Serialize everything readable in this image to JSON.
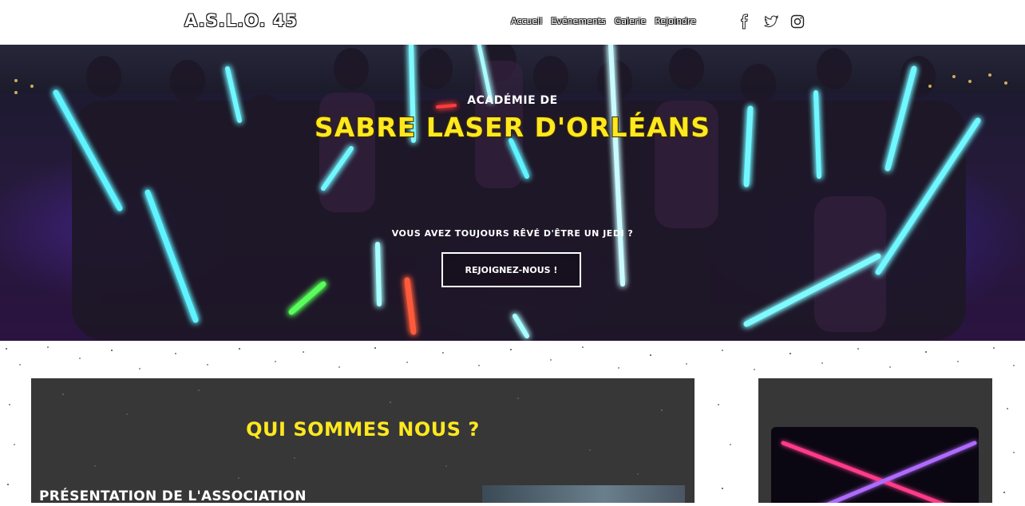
{
  "header": {
    "logo": "A.S.L.O. 45",
    "nav": [
      "Accueil",
      "Evénements",
      "Galerie",
      "Rejoindre"
    ],
    "social_icons": [
      "facebook-icon",
      "twitter-icon",
      "instagram-icon"
    ]
  },
  "hero": {
    "kicker": "ACADÉMIE DE",
    "title": "SABRE LASER D'ORLÉANS",
    "question": "VOUS AVEZ TOUJOURS RÊVÉ D'ÊTRE UN JEDI ?",
    "cta": "REJOIGNEZ-NOUS !"
  },
  "about": {
    "title": "QUI SOMMES NOUS ?",
    "subtitle": "PRÉSENTATION DE L'ASSOCIATION"
  },
  "colors": {
    "accent_yellow": "#ffe81f",
    "panel_bg": "#373737",
    "hero_bg": "#231a38"
  }
}
